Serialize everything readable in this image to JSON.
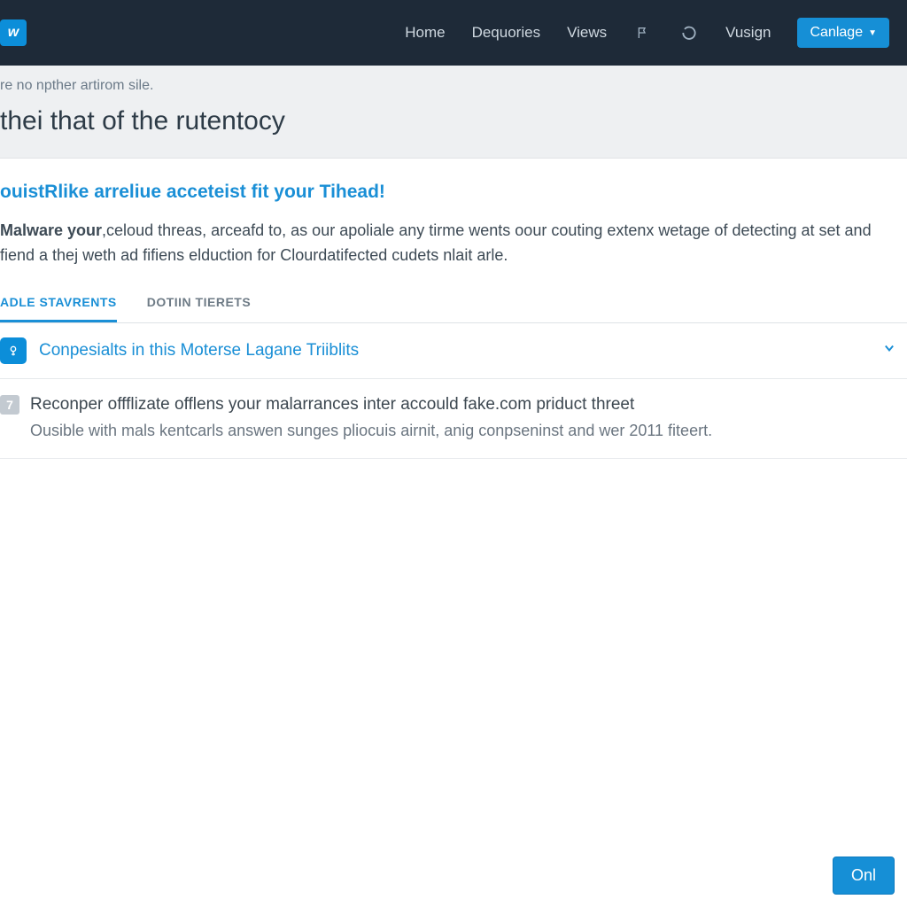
{
  "logo": "w",
  "nav": {
    "home": "Home",
    "dequories": "Dequories",
    "views": "Views",
    "vusign": "Vusign",
    "primary": "Canlage"
  },
  "subheader": {
    "crumb": "re no npther artirom sile.",
    "title": "thei that of the rutentocy"
  },
  "promo": {
    "title": "ouistRlike arreliue acceteist fit your Tihead!",
    "lead": "Malware your",
    "body": ",celoud threas, arceafd to, as our apoliale any tirme wents oour couting extenx wetage of detecting at set and fiend a thej weth ad fifiens elduction for Clourdatifected cudets nlait arle."
  },
  "tabs": {
    "active": "ADLE STAVRENTS",
    "second": "DOTIIN TIERETS"
  },
  "accordion": {
    "badge_char": "?",
    "title": "Conpesialts in this Moterse Lagane Triiblits"
  },
  "entry": {
    "badge": "7",
    "line1": "Reconper offflizate offlens your malarrances inter accould fake.com priduct threet",
    "line2": "Ousible with mals kentcarls answen sunges pliocuis airnit, anig conpseninst and wer 2011 fiteert."
  },
  "footer": {
    "btn": "Onl"
  }
}
